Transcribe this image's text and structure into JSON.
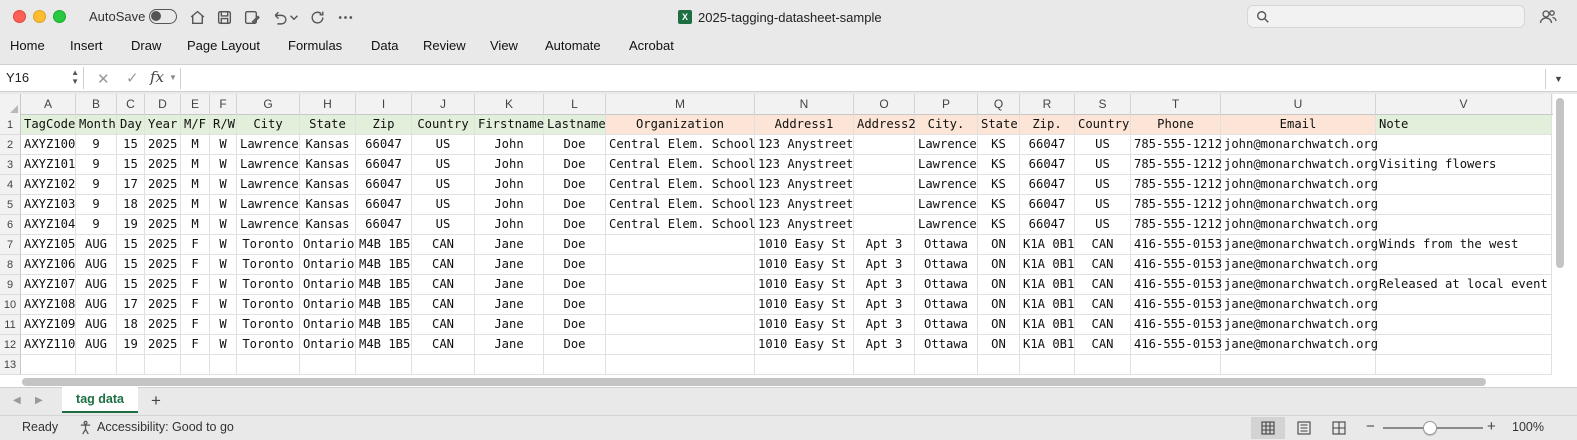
{
  "titlebar": {
    "autosave_label": "AutoSave",
    "autosave_on": false,
    "document_title": "2025-tagging-datasheet-sample",
    "search_placeholder": ""
  },
  "ribbon": {
    "tabs": [
      "Home",
      "Insert",
      "Draw",
      "Page Layout",
      "Formulas",
      "Data",
      "Review",
      "View",
      "Automate",
      "Acrobat"
    ]
  },
  "formula_bar": {
    "name_box": "Y16",
    "fx_label": "fx",
    "formula": ""
  },
  "colors": {
    "header_green": "#e2efda",
    "header_peach": "#fce4d6",
    "excel_green": "#1d6f42"
  },
  "sheet": {
    "columns": [
      "A",
      "B",
      "C",
      "D",
      "E",
      "F",
      "G",
      "H",
      "I",
      "J",
      "K",
      "L",
      "M",
      "N",
      "O",
      "P",
      "Q",
      "R",
      "S",
      "T",
      "U",
      "V"
    ],
    "row_numbers": [
      "1",
      "2",
      "3",
      "4",
      "5",
      "6",
      "7",
      "8",
      "9",
      "10",
      "11",
      "12",
      "13"
    ],
    "rows": [
      [
        "TagCode",
        "Month",
        "Day",
        "Year",
        "M/F",
        "R/W",
        "City",
        "State",
        "Zip",
        "Country",
        "Firstname",
        "Lastname",
        "Organization",
        "Address1",
        "Address2",
        "City.",
        "State.",
        "Zip.",
        "Country.",
        "Phone",
        "Email",
        "Note"
      ],
      [
        "AXYZ100",
        "9",
        "15",
        "2025",
        "M",
        "W",
        "Lawrence",
        "Kansas",
        "66047",
        "US",
        "John",
        "Doe",
        "Central Elem. School",
        "123 Anystreet",
        "",
        "Lawrence",
        "KS",
        "66047",
        "US",
        "785-555-1212",
        "john@monarchwatch.org",
        ""
      ],
      [
        "AXYZ101",
        "9",
        "15",
        "2025",
        "M",
        "W",
        "Lawrence",
        "Kansas",
        "66047",
        "US",
        "John",
        "Doe",
        "Central Elem. School",
        "123 Anystreet",
        "",
        "Lawrence",
        "KS",
        "66047",
        "US",
        "785-555-1212",
        "john@monarchwatch.org",
        "Visiting flowers"
      ],
      [
        "AXYZ102",
        "9",
        "17",
        "2025",
        "M",
        "W",
        "Lawrence",
        "Kansas",
        "66047",
        "US",
        "John",
        "Doe",
        "Central Elem. School",
        "123 Anystreet",
        "",
        "Lawrence",
        "KS",
        "66047",
        "US",
        "785-555-1212",
        "john@monarchwatch.org",
        ""
      ],
      [
        "AXYZ103",
        "9",
        "18",
        "2025",
        "M",
        "W",
        "Lawrence",
        "Kansas",
        "66047",
        "US",
        "John",
        "Doe",
        "Central Elem. School",
        "123 Anystreet",
        "",
        "Lawrence",
        "KS",
        "66047",
        "US",
        "785-555-1212",
        "john@monarchwatch.org",
        ""
      ],
      [
        "AXYZ104",
        "9",
        "19",
        "2025",
        "M",
        "W",
        "Lawrence",
        "Kansas",
        "66047",
        "US",
        "John",
        "Doe",
        "Central Elem. School",
        "123 Anystreet",
        "",
        "Lawrence",
        "KS",
        "66047",
        "US",
        "785-555-1212",
        "john@monarchwatch.org",
        ""
      ],
      [
        "AXYZ105",
        "AUG",
        "15",
        "2025",
        "F",
        "W",
        "Toronto",
        "Ontario",
        "M4B 1B5",
        "CAN",
        "Jane",
        "Doe",
        "",
        "1010 Easy St",
        "Apt 3",
        "Ottawa",
        "ON",
        "K1A 0B1",
        "CAN",
        "416-555-0153",
        "jane@monarchwatch.org",
        "Winds from the west"
      ],
      [
        "AXYZ106",
        "AUG",
        "15",
        "2025",
        "F",
        "W",
        "Toronto",
        "Ontario",
        "M4B 1B5",
        "CAN",
        "Jane",
        "Doe",
        "",
        "1010 Easy St",
        "Apt 3",
        "Ottawa",
        "ON",
        "K1A 0B1",
        "CAN",
        "416-555-0153",
        "jane@monarchwatch.org",
        ""
      ],
      [
        "AXYZ107",
        "AUG",
        "15",
        "2025",
        "F",
        "W",
        "Toronto",
        "Ontario",
        "M4B 1B5",
        "CAN",
        "Jane",
        "Doe",
        "",
        "1010 Easy St",
        "Apt 3",
        "Ottawa",
        "ON",
        "K1A 0B1",
        "CAN",
        "416-555-0153",
        "jane@monarchwatch.org",
        "Released at local event"
      ],
      [
        "AXYZ108",
        "AUG",
        "17",
        "2025",
        "F",
        "W",
        "Toronto",
        "Ontario",
        "M4B 1B5",
        "CAN",
        "Jane",
        "Doe",
        "",
        "1010 Easy St",
        "Apt 3",
        "Ottawa",
        "ON",
        "K1A 0B1",
        "CAN",
        "416-555-0153",
        "jane@monarchwatch.org",
        ""
      ],
      [
        "AXYZ109",
        "AUG",
        "18",
        "2025",
        "F",
        "W",
        "Toronto",
        "Ontario",
        "M4B 1B5",
        "CAN",
        "Jane",
        "Doe",
        "",
        "1010 Easy St",
        "Apt 3",
        "Ottawa",
        "ON",
        "K1A 0B1",
        "CAN",
        "416-555-0153",
        "jane@monarchwatch.org",
        ""
      ],
      [
        "AXYZ110",
        "AUG",
        "19",
        "2025",
        "F",
        "W",
        "Toronto",
        "Ontario",
        "M4B 1B5",
        "CAN",
        "Jane",
        "Doe",
        "",
        "1010 Easy St",
        "Apt 3",
        "Ottawa",
        "ON",
        "K1A 0B1",
        "CAN",
        "416-555-0153",
        "jane@monarchwatch.org",
        ""
      ],
      [
        "",
        "",
        "",
        "",
        "",
        "",
        "",
        "",
        "",
        "",
        "",
        "",
        "",
        "",
        "",
        "",
        "",
        "",
        "",
        "",
        "",
        ""
      ]
    ]
  },
  "sheet_tabs": {
    "active": "tag data",
    "add_label": "+"
  },
  "statusbar": {
    "ready": "Ready",
    "accessibility": "Accessibility: Good to go",
    "zoom_level": "100%",
    "zoom_fraction": 0.5
  }
}
